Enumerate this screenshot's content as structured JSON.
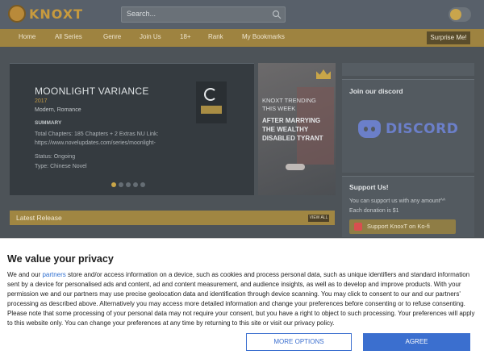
{
  "header": {
    "logo_text": "KNOXT",
    "search_placeholder": "Search..."
  },
  "nav": {
    "items": [
      {
        "label": "Home"
      },
      {
        "label": "All Series"
      },
      {
        "label": "Genre"
      },
      {
        "label": "Join Us"
      },
      {
        "label": "18+"
      },
      {
        "label": "Rank"
      },
      {
        "label": "My Bookmarks"
      }
    ],
    "surprise_label": "Surprise Me!"
  },
  "slider": {
    "title": "MOONLIGHT VARIANCE",
    "year": "2017",
    "genres": "Modern, Romance",
    "summary_heading": "SUMMARY",
    "summary": "Total Chapters: 185 Chapters + 2 Extras NU Link: https://www.novelupdates.com/series/moonlight-",
    "status": "Status: Ongoing",
    "type": "Type: Chinese Novel",
    "dots": 5,
    "active_dot": 0
  },
  "trending": {
    "heading": "KNOXT TRENDING THIS WEEK",
    "title": "AFTER MARRYING THE WEALTHY DISABLED TYRANT"
  },
  "sidebar": {
    "discord_heading": "Join our discord",
    "discord_word": "DISCORD",
    "support_heading": "Support Us!",
    "support_line1": "You can support us with any amount^^",
    "support_line2": "Each donation is $1",
    "kofi_label": "Support KnoxT on Ko-fi"
  },
  "latest": {
    "heading": "Latest Release",
    "view_all": "VIEW ALL"
  },
  "consent": {
    "heading": "We value your privacy",
    "text_before_link": "We and our ",
    "link_text": "partners",
    "text_after_link": " store and/or access information on a device, such as cookies and process personal data, such as unique identifiers and standard information sent by a device for personalised ads and content, ad and content measurement, and audience insights, as well as to develop and improve products. With your permission we and our partners may use precise geolocation data and identification through device scanning. You may click to consent to our and our partners' processing as described above. Alternatively you may access more detailed information and change your preferences before consenting or to refuse consenting. Please note that some processing of your personal data may not require your consent, but you have a right to object to such processing. Your preferences will apply to this website only. You can change your preferences at any time by returning to this site or visit our privacy policy.",
    "more_options_label": "MORE OPTIONS",
    "agree_label": "AGREE"
  },
  "colors": {
    "accent_gold": "#c9a548",
    "consent_blue": "#3b6fcf",
    "discord_blue": "#6b7fc9"
  }
}
